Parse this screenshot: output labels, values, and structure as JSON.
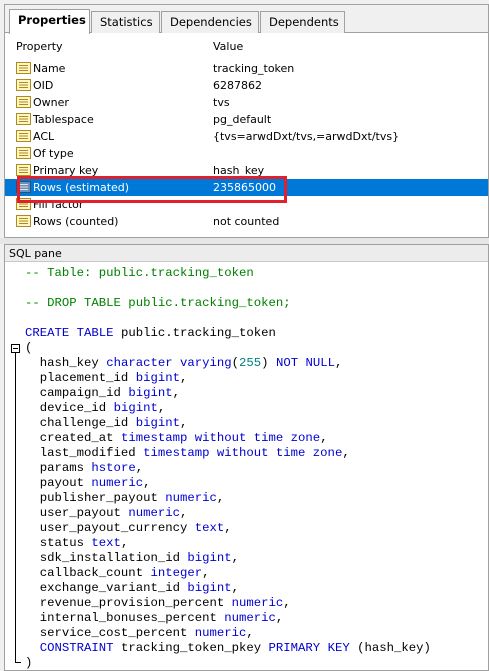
{
  "tabs": [
    {
      "label": "Properties",
      "active": true
    },
    {
      "label": "Statistics",
      "active": false
    },
    {
      "label": "Dependencies",
      "active": false
    },
    {
      "label": "Dependents",
      "active": false
    }
  ],
  "properties": {
    "header": {
      "property": "Property",
      "value": "Value"
    },
    "rows": [
      {
        "key": "Name",
        "value": "tracking_token"
      },
      {
        "key": "OID",
        "value": "6287862"
      },
      {
        "key": "Owner",
        "value": "tvs"
      },
      {
        "key": "Tablespace",
        "value": "pg_default"
      },
      {
        "key": "ACL",
        "value": "{tvs=arwdDxt/tvs,=arwdDxt/tvs}"
      },
      {
        "key": "Of type",
        "value": ""
      },
      {
        "key": "Primary key",
        "value": "hash_key"
      },
      {
        "key": "Rows (estimated)",
        "value": "235865000",
        "selected": true
      },
      {
        "key": "Fill factor",
        "value": ""
      },
      {
        "key": "Rows (counted)",
        "value": "not counted"
      }
    ]
  },
  "sql_pane": {
    "title": "SQL pane",
    "lines": [
      {
        "text": "-- Table: public.tracking_token"
      },
      {
        "text": ""
      },
      {
        "text": "-- DROP TABLE public.tracking_token;"
      },
      {
        "text": ""
      },
      {
        "text": "CREATE TABLE public.tracking_token"
      },
      {
        "text": "("
      },
      {
        "text": "  hash_key character varying(255) NOT NULL,"
      },
      {
        "text": "  placement_id bigint,"
      },
      {
        "text": "  campaign_id bigint,"
      },
      {
        "text": "  device_id bigint,"
      },
      {
        "text": "  challenge_id bigint,"
      },
      {
        "text": "  created_at timestamp without time zone,"
      },
      {
        "text": "  last_modified timestamp without time zone,"
      },
      {
        "text": "  params hstore,"
      },
      {
        "text": "  payout numeric,"
      },
      {
        "text": "  publisher_payout numeric,"
      },
      {
        "text": "  user_payout numeric,"
      },
      {
        "text": "  user_payout_currency text,"
      },
      {
        "text": "  status text,"
      },
      {
        "text": "  sdk_installation_id bigint,"
      },
      {
        "text": "  callback_count integer,"
      },
      {
        "text": "  exchange_variant_id bigint,"
      },
      {
        "text": "  revenue_provision_percent numeric,"
      },
      {
        "text": "  internal_bonuses_percent numeric,"
      },
      {
        "text": "  service_cost_percent numeric,"
      },
      {
        "text": "  CONSTRAINT tracking_token_pkey PRIMARY KEY (hash_key)"
      },
      {
        "text": ")"
      }
    ]
  },
  "colors": {
    "selection": "#0078d7",
    "highlight_border": "#e0202a",
    "comment": "#008000",
    "keyword": "#0000d0",
    "number": "#008080"
  }
}
